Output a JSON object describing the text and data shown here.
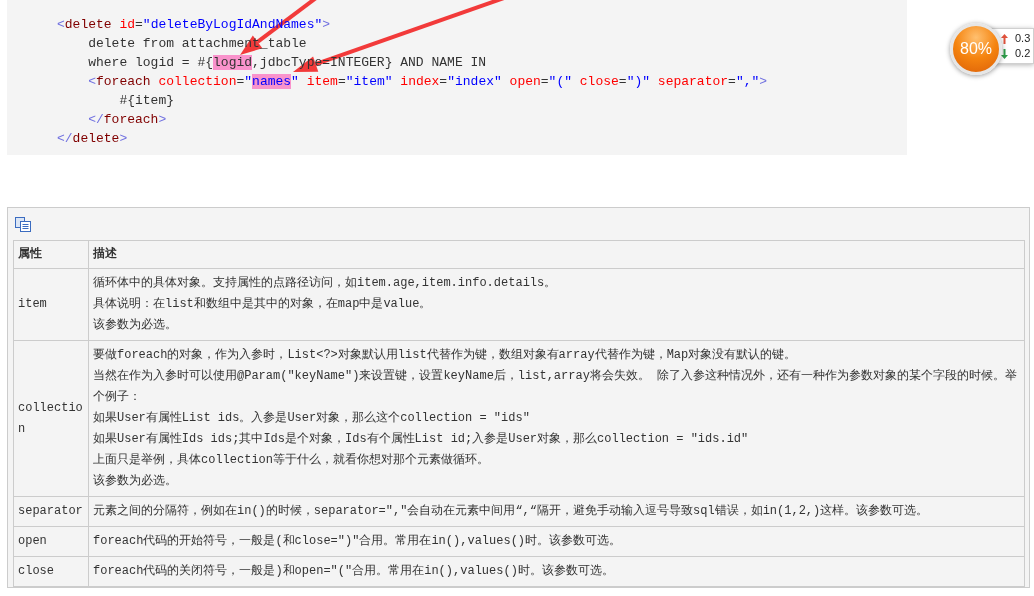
{
  "code_block": {
    "lines": [
      {
        "segments": [
          {
            "highlighted": false,
            "tokens": [
              {
                "kind": "bracket",
                "text": "<"
              },
              {
                "kind": "tag",
                "text": "delete"
              },
              {
                "kind": "attr",
                "text": " id"
              },
              {
                "kind": "plain",
                "text": "="
              },
              {
                "kind": "value",
                "text": "\"deleteByLogIdAndNames\""
              },
              {
                "kind": "bracket",
                "text": ">"
              }
            ]
          }
        ],
        "children": [
          {
            "segments": [
              {
                "highlighted": false,
                "tokens": [
                  {
                    "kind": "plain",
                    "text": "delete from attachment_table"
                  }
                ]
              }
            ]
          },
          {
            "segments": [
              {
                "highlighted": false,
                "tokens": [
                  {
                    "kind": "plain",
                    "text": "where logid = #{"
                  }
                ]
              },
              {
                "highlighted": true,
                "tokens": [
                  {
                    "kind": "plain",
                    "text": "logid"
                  }
                ]
              },
              {
                "highlighted": false,
                "tokens": [
                  {
                    "kind": "plain",
                    "text": ",jdbcType=INTEGER} AND NAME IN"
                  }
                ]
              }
            ]
          },
          {
            "segments": [
              {
                "highlighted": false,
                "tokens": [
                  {
                    "kind": "bracket",
                    "text": "<"
                  },
                  {
                    "kind": "tag",
                    "text": "foreach"
                  },
                  {
                    "kind": "attr",
                    "text": " collection"
                  },
                  {
                    "kind": "plain",
                    "text": "="
                  },
                  {
                    "kind": "value",
                    "text": "\""
                  }
                ]
              },
              {
                "highlighted": true,
                "tokens": [
                  {
                    "kind": "value",
                    "text": "names"
                  }
                ]
              },
              {
                "highlighted": false,
                "tokens": [
                  {
                    "kind": "value",
                    "text": "\""
                  },
                  {
                    "kind": "attr",
                    "text": " item"
                  },
                  {
                    "kind": "plain",
                    "text": "="
                  },
                  {
                    "kind": "value",
                    "text": "\"item\""
                  },
                  {
                    "kind": "attr",
                    "text": " index"
                  },
                  {
                    "kind": "plain",
                    "text": "="
                  },
                  {
                    "kind": "value",
                    "text": "\"index\""
                  },
                  {
                    "kind": "attr",
                    "text": " open"
                  },
                  {
                    "kind": "plain",
                    "text": "="
                  },
                  {
                    "kind": "value",
                    "text": "\"(\""
                  },
                  {
                    "kind": "attr",
                    "text": " close"
                  },
                  {
                    "kind": "plain",
                    "text": "="
                  },
                  {
                    "kind": "value",
                    "text": "\")\""
                  },
                  {
                    "kind": "attr",
                    "text": " separator"
                  },
                  {
                    "kind": "plain",
                    "text": "="
                  },
                  {
                    "kind": "value",
                    "text": "\",\""
                  },
                  {
                    "kind": "bracket",
                    "text": ">"
                  }
                ]
              }
            ],
            "children": [
              {
                "segments": [
                  {
                    "highlighted": false,
                    "tokens": [
                      {
                        "kind": "plain",
                        "text": "#{item}"
                      }
                    ]
                  }
                ]
              }
            ]
          },
          {
            "segments": [
              {
                "highlighted": false,
                "tokens": [
                  {
                    "kind": "bracket",
                    "text": "</"
                  },
                  {
                    "kind": "tag",
                    "text": "foreach"
                  },
                  {
                    "kind": "bracket",
                    "text": ">"
                  }
                ]
              }
            ]
          }
        ]
      },
      {
        "segments": [
          {
            "highlighted": false,
            "tokens": [
              {
                "kind": "bracket",
                "text": "</"
              },
              {
                "kind": "tag",
                "text": "delete"
              },
              {
                "kind": "bracket",
                "text": ">"
              }
            ]
          }
        ]
      }
    ]
  },
  "usage_ball": {
    "percent": "80%",
    "upload": "0.3",
    "download": "0.2"
  },
  "table": {
    "columns": [
      "属性",
      "描述"
    ],
    "rows": [
      {
        "attribute": "item",
        "description": [
          "循环体中的具体对象。支持属性的点路径访问，如item.age,item.info.details。",
          "具体说明：在list和数组中是其中的对象，在map中是value。",
          "该参数为必选。"
        ]
      },
      {
        "attribute": "collection",
        "description": [
          "要做foreach的对象，作为入参时，List<?>对象默认用list代替作为键，数组对象有array代替作为键，Map对象没有默认的键。",
          "当然在作为入参时可以使用@Param(\"keyName\")来设置键，设置keyName后，list,array将会失效。 除了入参这种情况外，还有一种作为参数对象的某个字段的时候。举个例子：",
          "如果User有属性List ids。入参是User对象，那么这个collection = \"ids\"",
          "如果User有属性Ids ids;其中Ids是个对象，Ids有个属性List id;入参是User对象，那么collection = \"ids.id\"",
          "上面只是举例，具体collection等于什么，就看你想对那个元素做循环。",
          "该参数为必选。"
        ]
      },
      {
        "attribute": "separator",
        "description": [
          "元素之间的分隔符，例如在in()的时候，separator=\",\"会自动在元素中间用“,“隔开，避免手动输入逗号导致sql错误，如in(1,2,)这样。该参数可选。"
        ]
      },
      {
        "attribute": "open",
        "description": [
          "foreach代码的开始符号，一般是(和close=\")\"合用。常用在in(),values()时。该参数可选。"
        ]
      },
      {
        "attribute": "close",
        "description": [
          "foreach代码的关闭符号，一般是)和open=\"(\"合用。常用在in(),values()时。该参数可选。"
        ]
      }
    ]
  }
}
